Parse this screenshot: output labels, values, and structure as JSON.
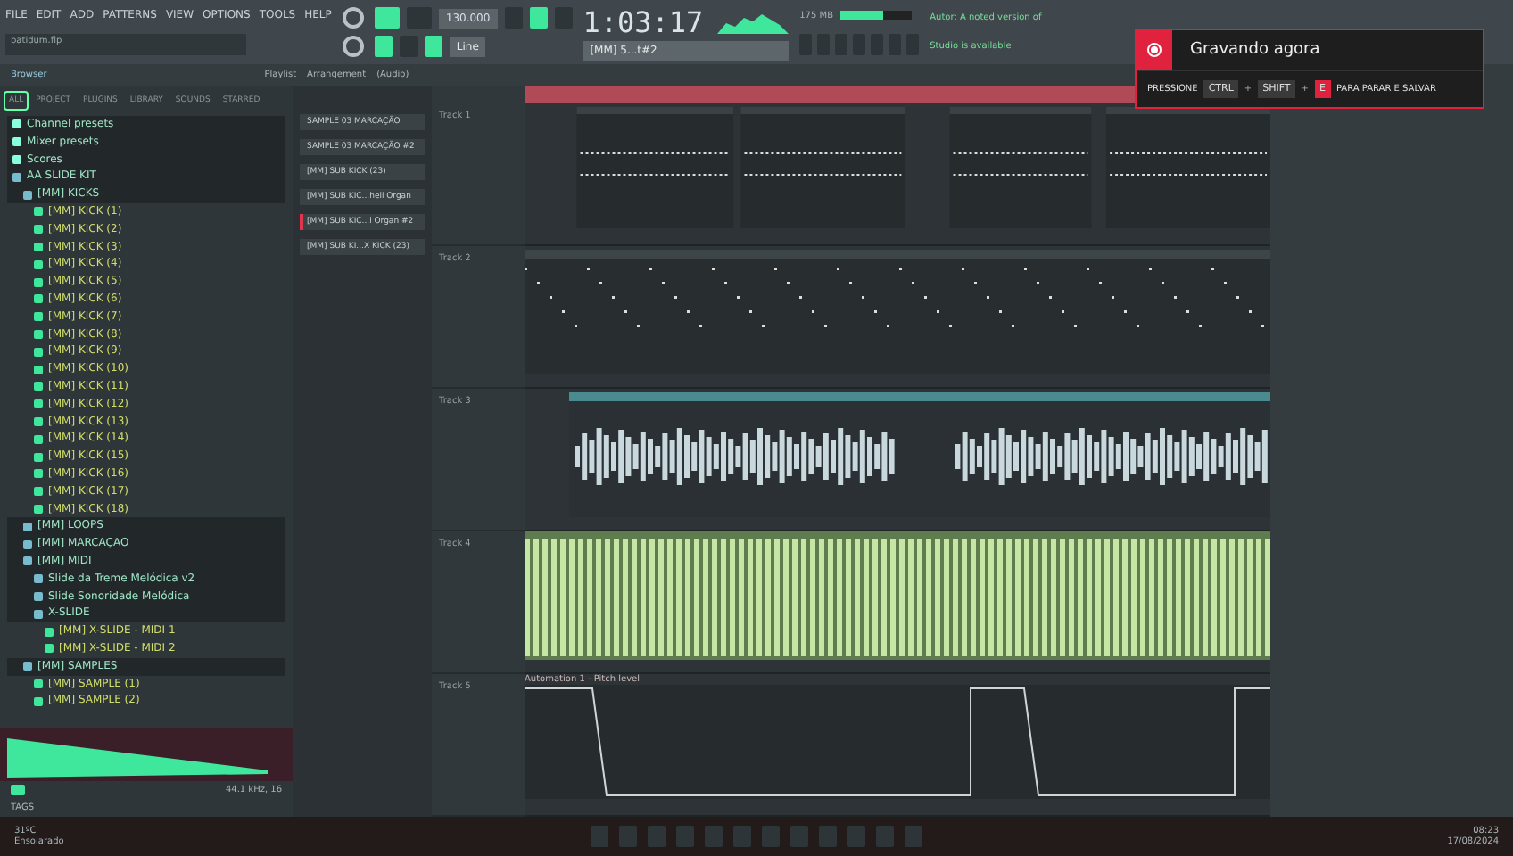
{
  "menu": [
    "FILE",
    "EDIT",
    "ADD",
    "PATTERNS",
    "VIEW",
    "OPTIONS",
    "TOOLS",
    "HELP"
  ],
  "hint": "batidum.flp",
  "tempo": "130.000",
  "song_time": "1:03:17",
  "pattern_selector": "[MM] 5...t#2",
  "snap": "Line",
  "cpu": {
    "memory": "175 MB",
    "level": 0.6
  },
  "hint_panel": [
    "Autor: A noted version of",
    "Studio is available"
  ],
  "browser": {
    "title": "Browser",
    "tabs": [
      {
        "label": "ALL",
        "selected": true
      },
      {
        "label": "PROJECT",
        "selected": false
      },
      {
        "label": "PLUGINS",
        "selected": false
      },
      {
        "label": "LIBRARY",
        "selected": false
      },
      {
        "label": "SOUNDS",
        "selected": false
      },
      {
        "label": "STARRED",
        "selected": false
      }
    ],
    "tree": [
      {
        "label": "Channel presets",
        "kind": "preset"
      },
      {
        "label": "Mixer presets",
        "kind": "preset"
      },
      {
        "label": "Scores",
        "kind": "preset"
      },
      {
        "label": "AA SLIDE KIT",
        "kind": "folder",
        "children": [
          {
            "label": "[MM] KICKS",
            "kind": "folder",
            "children": [
              {
                "label": "[MM] KICK (1)",
                "kind": "sample"
              },
              {
                "label": "[MM] KICK (2)",
                "kind": "sample"
              },
              {
                "label": "[MM] KICK (3)",
                "kind": "sample"
              },
              {
                "label": "[MM] KICK (4)",
                "kind": "sample"
              },
              {
                "label": "[MM] KICK (5)",
                "kind": "sample"
              },
              {
                "label": "[MM] KICK (6)",
                "kind": "sample"
              },
              {
                "label": "[MM] KICK (7)",
                "kind": "sample"
              },
              {
                "label": "[MM] KICK (8)",
                "kind": "sample"
              },
              {
                "label": "[MM] KICK (9)",
                "kind": "sample"
              },
              {
                "label": "[MM] KICK (10)",
                "kind": "sample"
              },
              {
                "label": "[MM] KICK (11)",
                "kind": "sample"
              },
              {
                "label": "[MM] KICK (12)",
                "kind": "sample"
              },
              {
                "label": "[MM] KICK (13)",
                "kind": "sample"
              },
              {
                "label": "[MM] KICK (14)",
                "kind": "sample"
              },
              {
                "label": "[MM] KICK (15)",
                "kind": "sample"
              },
              {
                "label": "[MM] KICK (16)",
                "kind": "sample"
              },
              {
                "label": "[MM] KICK (17)",
                "kind": "sample"
              },
              {
                "label": "[MM] KICK (18)",
                "kind": "sample"
              }
            ]
          },
          {
            "label": "[MM] LOOPS",
            "kind": "folder"
          },
          {
            "label": "[MM] MARCAÇAO",
            "kind": "folder"
          },
          {
            "label": "[MM] MIDI",
            "kind": "folder",
            "children": [
              {
                "label": "Slide da Treme Melódica v2",
                "kind": "folder"
              },
              {
                "label": "Slide Sonoridade Melódica",
                "kind": "folder"
              },
              {
                "label": "X-SLIDE",
                "kind": "folder",
                "children": [
                  {
                    "label": "[MM] X-SLIDE - MIDI 1",
                    "kind": "midi"
                  },
                  {
                    "label": "[MM] X-SLIDE - MIDI 2",
                    "kind": "midi"
                  }
                ]
              }
            ]
          },
          {
            "label": "[MM] SAMPLES",
            "kind": "folder",
            "children": [
              {
                "label": "[MM] SAMPLE (1)",
                "kind": "sample"
              },
              {
                "label": "[MM] SAMPLE (2)",
                "kind": "sample"
              }
            ]
          }
        ]
      }
    ],
    "sample_info": "44.1 kHz, 16",
    "search_placeholder": "TAGS"
  },
  "playlist": {
    "title": "Playlist",
    "breadcrumb": "Arrangement",
    "section": "(Audio)"
  },
  "patterns": [
    {
      "label": "SAMPLE 03 MARCAÇÃO",
      "selected": false
    },
    {
      "label": "SAMPLE 03 MARCAÇÃO #2",
      "selected": false
    },
    {
      "label": "[MM] SUB KICK (23)",
      "selected": false
    },
    {
      "label": "[MM] SUB KIC...hell Organ",
      "selected": false
    },
    {
      "label": "[MM] SUB KIC...l Organ #2",
      "selected": true
    },
    {
      "label": "[MM] SUB KI...X KICK (23)",
      "selected": false
    }
  ],
  "tracks": [
    {
      "name": "Track 1",
      "kind": "pattern"
    },
    {
      "name": "Track 2",
      "kind": "notes"
    },
    {
      "name": "Track 3",
      "kind": "audio"
    },
    {
      "name": "Track 4",
      "kind": "bars"
    },
    {
      "name": "Track 5",
      "kind": "automation",
      "clip": "Automation 1 - Pitch level"
    }
  ],
  "notification": {
    "title": "Gravando agora",
    "prefix": "PRESSIONE",
    "keys": [
      "CTRL",
      "SHIFT",
      "E"
    ],
    "joiner": "+",
    "suffix": "PARA PARAR E SALVAR"
  },
  "taskbar": {
    "temperature": "31ºC",
    "weather": "Ensolarado",
    "time": "08:23",
    "date": "17/08/2024"
  }
}
